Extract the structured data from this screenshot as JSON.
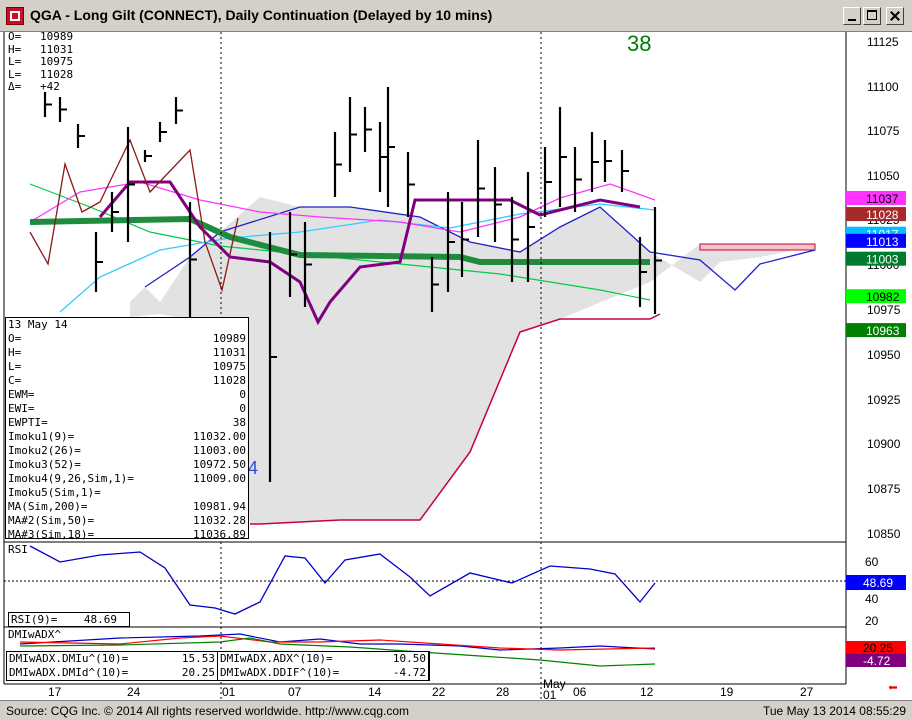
{
  "window": {
    "title": "QGA - Long Gilt (CONNECT), Daily Continuation (Delayed by 10 mins)"
  },
  "ohlc": [
    {
      "k": "O=",
      "v": "10989"
    },
    {
      "k": "H=",
      "v": "11031"
    },
    {
      "k": "L=",
      "v": "10975"
    },
    {
      "k": "L=",
      "v": "11028"
    },
    {
      "k": "Δ=",
      "v": "+42"
    }
  ],
  "ewpti_number": "38",
  "stray_label": "4",
  "data_window": {
    "date": "13 May 14",
    "rows": [
      {
        "k": "O=",
        "v": "10989"
      },
      {
        "k": "H=",
        "v": "11031"
      },
      {
        "k": "L=",
        "v": "10975"
      },
      {
        "k": "C=",
        "v": "11028"
      },
      {
        "k": "EWM=",
        "v": "0"
      },
      {
        "k": "EWI=",
        "v": "0"
      },
      {
        "k": "EWPTI=",
        "v": "38"
      },
      {
        "k": "Imoku1(9)=",
        "v": "11032.00"
      },
      {
        "k": "Imoku2(26)=",
        "v": "11003.00"
      },
      {
        "k": "Imoku3(52)=",
        "v": "10972.50"
      },
      {
        "k": "Imoku4(9,26,Sim,1)=",
        "v": "11009.00"
      },
      {
        "k": "Imoku5(Sim,1)=",
        "v": ""
      },
      {
        "k": "MA(Sim,200)=",
        "v": "10981.94"
      },
      {
        "k": "MA#2(Sim,50)=",
        "v": "11032.28"
      },
      {
        "k": "MA#3(Sim,18)=",
        "v": "11036.89"
      }
    ]
  },
  "price_axis": {
    "ticks": [
      "11125",
      "11100",
      "11075",
      "11050",
      "11025",
      "11000",
      "10975",
      "10950",
      "10925",
      "10900",
      "10875",
      "10850"
    ]
  },
  "price_tags": [
    {
      "text": "11037",
      "bg": "#ff33ff",
      "fg": "#000000",
      "price": 11037
    },
    {
      "text": "11028",
      "bg": "#a52a2a",
      "fg": "#ffffff",
      "price": 11028
    },
    {
      "text": "11017",
      "bg": "#00bfff",
      "fg": "#ffffff",
      "price": 11017
    },
    {
      "text": "11013",
      "bg": "#0000ff",
      "fg": "#ffffff",
      "price": 11013
    },
    {
      "text": "11003",
      "bg": "#007a2e",
      "fg": "#ffffff",
      "price": 11003
    },
    {
      "text": "10982",
      "bg": "#00ff00",
      "fg": "#000000",
      "price": 10982
    },
    {
      "text": "10963",
      "bg": "#008000",
      "fg": "#ffffff",
      "price": 10963
    }
  ],
  "rsi_panel": {
    "title": "RSI",
    "value_label": "RSI(9)=",
    "value": "48.69",
    "ticks": [
      "60",
      "40",
      "20"
    ],
    "tag": {
      "text": "48.69",
      "bg": "#0000ff",
      "fg": "#ffffff"
    }
  },
  "dmi_panel": {
    "title": "DMIwADX^",
    "values": [
      [
        {
          "k": "DMIwADX.DMIu^(10)=",
          "v": "15.53"
        },
        {
          "k": "DMIwADX.ADX^(10)=",
          "v": "10.50"
        }
      ],
      [
        {
          "k": "DMIwADX.DMId^(10)=",
          "v": "20.25"
        },
        {
          "k": "DMIwADX.DDIF^(10)=",
          "v": "-4.72"
        }
      ]
    ],
    "tags": [
      {
        "text": "20.25",
        "bg": "#ff0000",
        "fg": "#000000"
      },
      {
        "text": "-4.72",
        "bg": "#800080",
        "fg": "#ffffff"
      }
    ]
  },
  "date_axis": {
    "labels": [
      "17",
      "24",
      "01",
      "07",
      "14",
      "22",
      "28",
      "May",
      "01",
      "06",
      "12",
      "19",
      "27"
    ],
    "month_label": "May"
  },
  "status": {
    "source": "Source: CQG Inc. © 2014 All rights reserved worldwide. http://www.cqg.com",
    "timestamp": "Tue May 13 2014 08:55:29"
  },
  "colors": {
    "tenkan": "#800080",
    "kijun": "#1e8c3c",
    "ma200": "#00cc44",
    "ma50": "#33ccff",
    "ma18": "#ff33ff",
    "cloud_edge": "#c8003c",
    "rsi_line": "#0000cc",
    "accent_red": "#e00000"
  }
}
